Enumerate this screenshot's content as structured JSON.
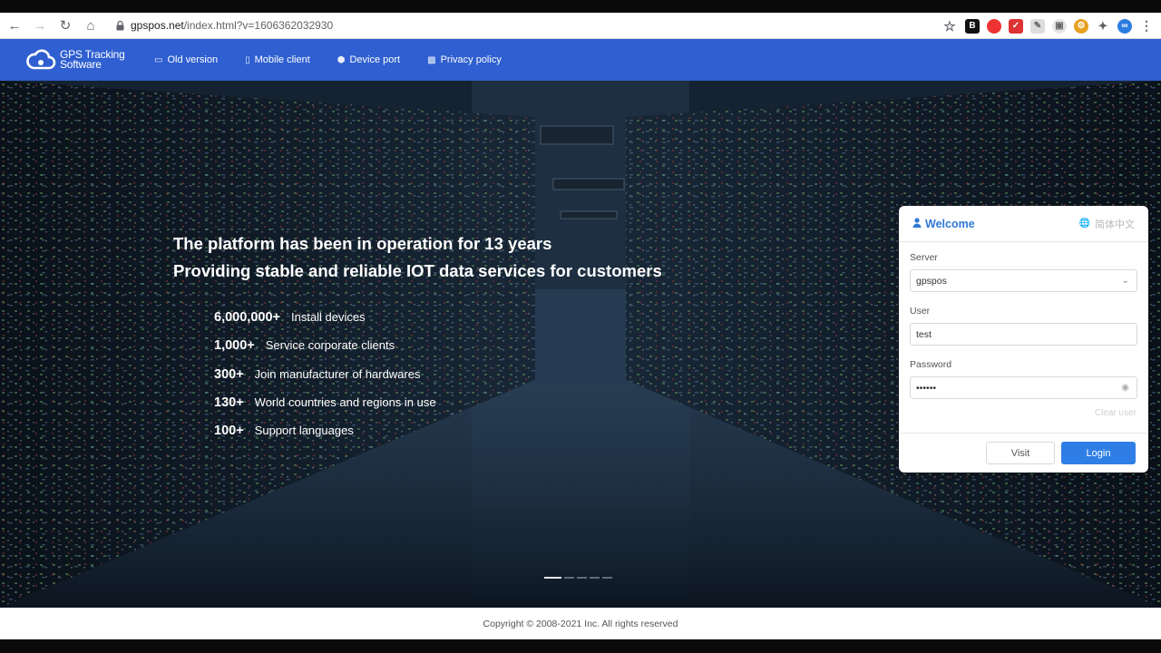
{
  "browser": {
    "url_domain": "gpspos.net",
    "url_path": "/index.html?v=1606362032930"
  },
  "header": {
    "logo_text": "GPS Tracking Software",
    "menu": [
      {
        "label": "Old version",
        "icon": "monitor-icon"
      },
      {
        "label": "Mobile client",
        "icon": "mobile-icon"
      },
      {
        "label": "Device port",
        "icon": "cube-icon"
      },
      {
        "label": "Privacy policy",
        "icon": "book-icon"
      }
    ],
    "brand_color": "#2f5fd0"
  },
  "hero": {
    "headline_1": "The platform has been in operation for 13 years",
    "headline_2": "Providing stable and reliable IOT data services for customers",
    "stats": [
      {
        "num": "6,000,000+",
        "desc": "Install devices"
      },
      {
        "num": "1,000+",
        "desc": "Service corporate clients"
      },
      {
        "num": "300+",
        "desc": "Join manufacturer of hardwares"
      },
      {
        "num": "130+",
        "desc": "World countries and regions in use"
      },
      {
        "num": "100+",
        "desc": "Support languages"
      }
    ],
    "carousel_slides": 5,
    "carousel_active": 1
  },
  "login": {
    "title": "Welcome",
    "language": "简体中文",
    "server_label": "Server",
    "server_value": "gpspos",
    "user_label": "User",
    "user_value": "test",
    "password_label": "Password",
    "password_value": "••••••",
    "clear_user": "Clear user",
    "visit_label": "Visit",
    "login_label": "Login",
    "accent_color": "#2f7ee6"
  },
  "footer": {
    "copyright": "Copyright © 2008-2021 Inc. All rights reserved"
  }
}
